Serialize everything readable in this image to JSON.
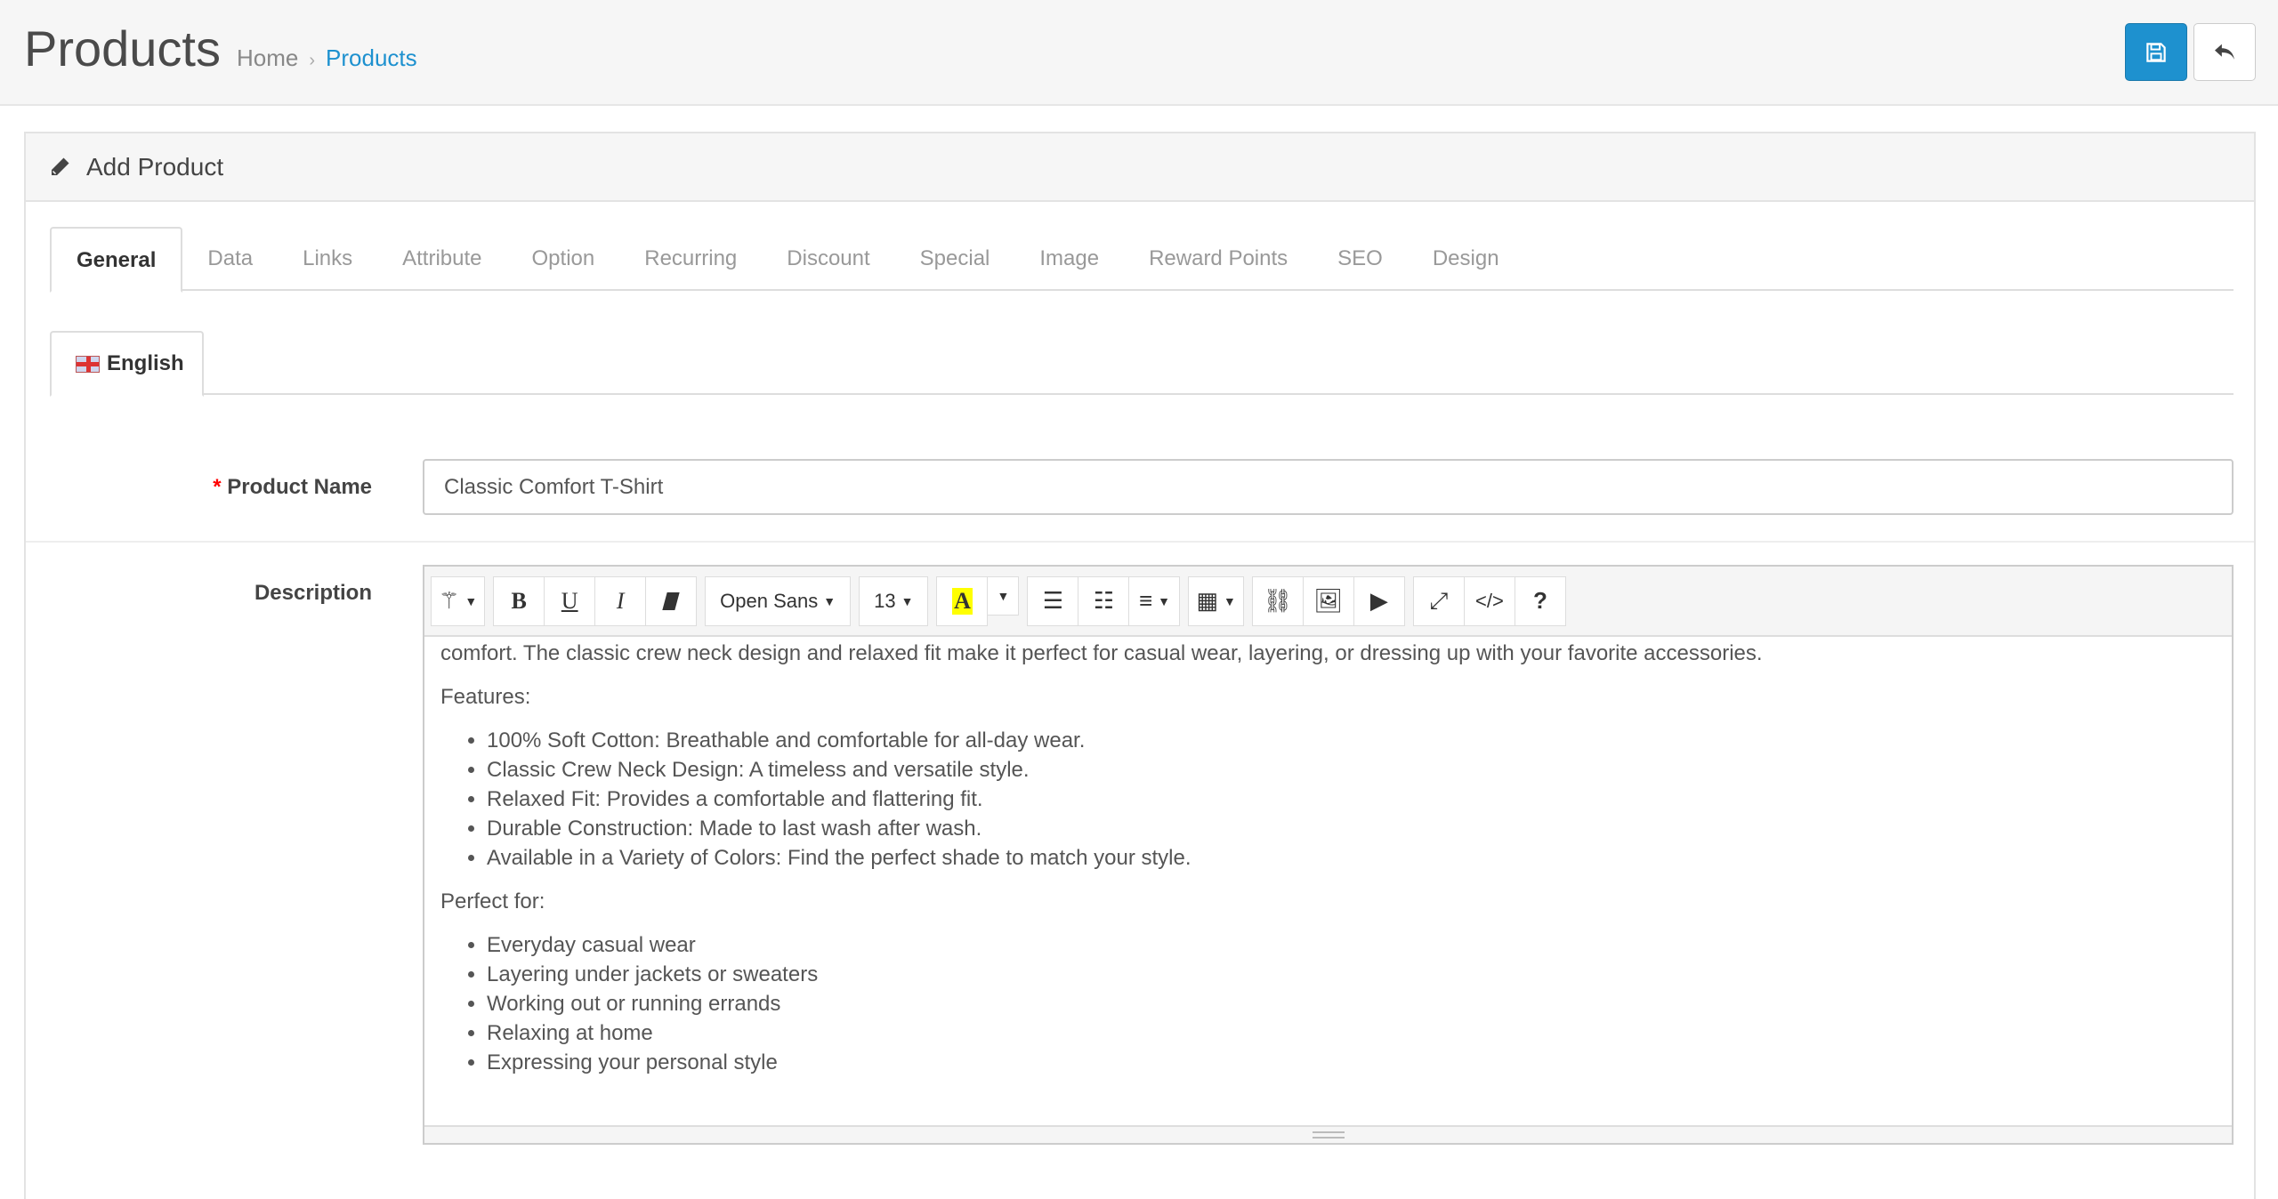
{
  "header": {
    "title": "Products",
    "breadcrumb": [
      {
        "label": "Home"
      },
      {
        "label": "Products"
      }
    ],
    "save_icon": "floppy-disk-icon",
    "back_icon": "reply-arrow-icon"
  },
  "colors": {
    "primary": "#1e91cf",
    "required": "#ff0000"
  },
  "panel": {
    "title": "Add Product",
    "icon": "pencil-icon"
  },
  "tabs": [
    "General",
    "Data",
    "Links",
    "Attribute",
    "Option",
    "Recurring",
    "Discount",
    "Special",
    "Image",
    "Reward Points",
    "SEO",
    "Design"
  ],
  "active_tab": "General",
  "language_tab": "English",
  "form": {
    "product_name": {
      "label": "Product Name",
      "required_mark": "*",
      "value": "Classic Comfort T-Shirt"
    },
    "description": {
      "label": "Description"
    }
  },
  "editor": {
    "font_family": "Open Sans",
    "font_size": "13",
    "color_letter": "A",
    "highlight_color": "#ffff00",
    "content": {
      "intro_line": "comfort. The classic crew neck design and relaxed fit make it perfect for casual wear, layering, or dressing up with your favorite accessories.",
      "features_heading": "Features:",
      "features": [
        "100% Soft Cotton: Breathable and comfortable for all-day wear.",
        "Classic Crew Neck Design: A timeless and versatile style.",
        "Relaxed Fit: Provides a comfortable and flattering fit.",
        "Durable Construction: Made to last wash after wash.",
        "Available in a Variety of Colors: Find the perfect shade to match your style."
      ],
      "perfect_heading": "Perfect for:",
      "perfect_for": [
        "Everyday casual wear",
        "Layering under jackets or sweaters",
        "Working out or running errands",
        "Relaxing at home",
        "Expressing your personal style"
      ]
    }
  }
}
